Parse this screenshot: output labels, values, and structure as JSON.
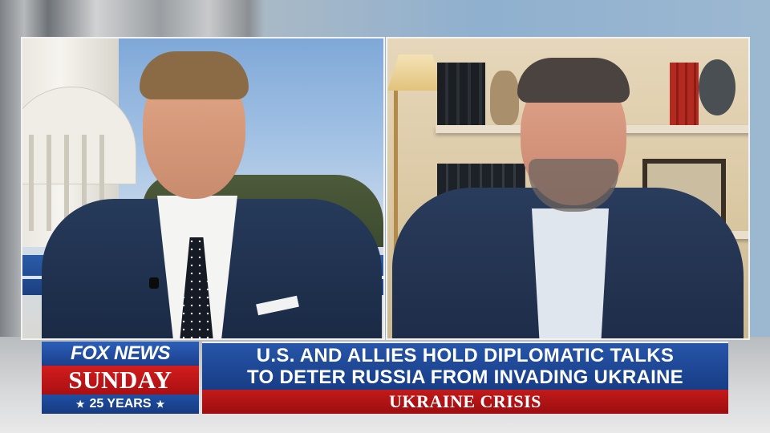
{
  "broadcast": {
    "network_logo": "FOX NEWS",
    "show_name": "SUNDAY",
    "anniversary": "25 YEARS",
    "anniversary_star": "★"
  },
  "lower_third": {
    "headline_line_1": "U.S. AND ALLIES HOLD DIPLOMATIC TALKS",
    "headline_line_2": "TO DETER RUSSIA FROM INVADING UKRAINE",
    "banner": "UKRAINE CRISIS"
  },
  "colors": {
    "network_blue": "#1f4fa5",
    "network_red": "#c21a1a",
    "text_white": "#ffffff"
  }
}
